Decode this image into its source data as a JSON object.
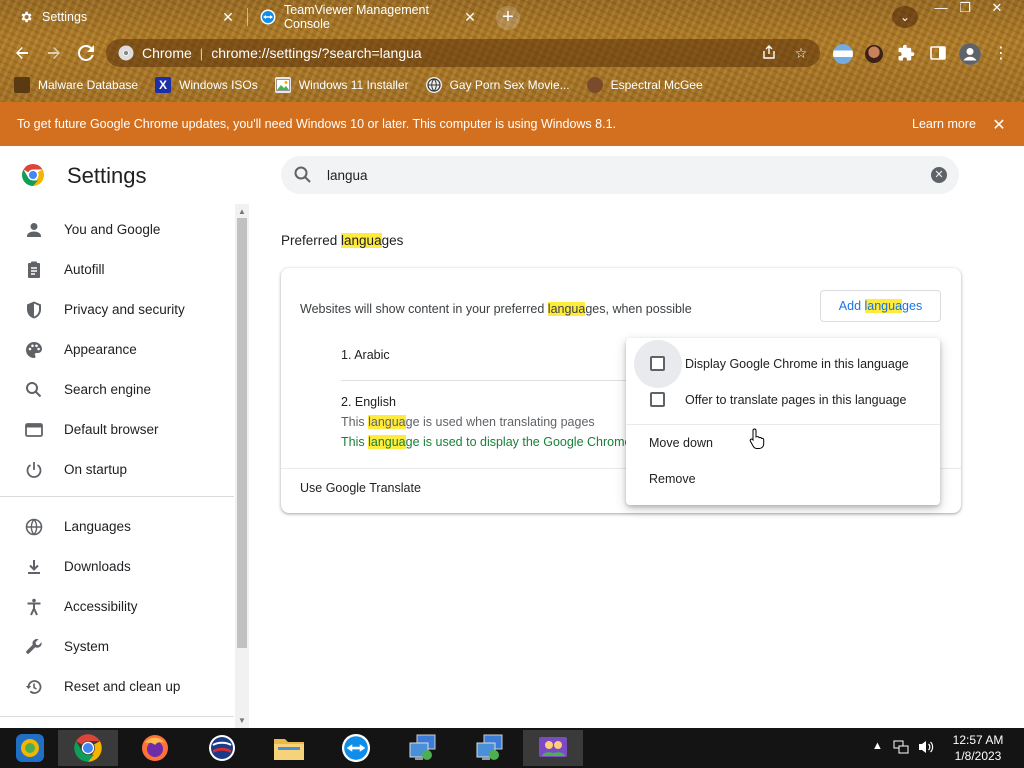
{
  "tabs": [
    {
      "title": "Settings",
      "icon": "gear-icon",
      "active": true
    },
    {
      "title": "TeamViewer Management Console",
      "icon": "teamviewer-icon",
      "active": false
    }
  ],
  "window_controls": {
    "minimize": "—",
    "restore": "❐",
    "close": "✕"
  },
  "toolbar": {
    "site_name": "Chrome",
    "url": "chrome://settings/?search=langua"
  },
  "bookmarks": [
    {
      "label": "Malware Database",
      "icon": "malware-database-icon"
    },
    {
      "label": "Windows ISOs",
      "icon": "windows-isos-icon"
    },
    {
      "label": "Windows 11 Installer",
      "icon": "image-icon"
    },
    {
      "label": "Gay Porn Sex Movie...",
      "icon": "globe-favicon-icon"
    },
    {
      "label": "Espectral McGee",
      "icon": "person-favicon-icon"
    }
  ],
  "infobar": {
    "message": "To get future Google Chrome updates, you'll need Windows 10 or later. This computer is using Windows 8.1.",
    "link": "Learn more"
  },
  "settings": {
    "title": "Settings",
    "search_value": "langua"
  },
  "sidenav": {
    "items": [
      {
        "label": "You and Google",
        "icon": "person-icon"
      },
      {
        "label": "Autofill",
        "icon": "clipboard-icon"
      },
      {
        "label": "Privacy and security",
        "icon": "shield-icon"
      },
      {
        "label": "Appearance",
        "icon": "palette-icon"
      },
      {
        "label": "Search engine",
        "icon": "search-icon"
      },
      {
        "label": "Default browser",
        "icon": "browser-window-icon"
      },
      {
        "label": "On startup",
        "icon": "power-icon"
      },
      {
        "label": "Languages",
        "icon": "globe-icon"
      },
      {
        "label": "Downloads",
        "icon": "download-icon"
      },
      {
        "label": "Accessibility",
        "icon": "accessibility-icon"
      },
      {
        "label": "System",
        "icon": "wrench-icon"
      },
      {
        "label": "Reset and clean up",
        "icon": "restore-icon"
      }
    ]
  },
  "languages_section": {
    "title_pre": "Preferred ",
    "title_hl": "langua",
    "title_post": "ges",
    "desc_pre": "Websites will show content in your preferred ",
    "desc_hl": "langua",
    "desc_post": "ges, when possible",
    "add_pre": "Add ",
    "add_hl": "langua",
    "add_post": "ges",
    "lang1": "1. Arabic",
    "lang2": "2. English",
    "note1_pre": "This ",
    "note1_hl": "langua",
    "note1_post": "ge is used when translating pages",
    "note2_pre": "This ",
    "note2_hl": "langua",
    "note2_post": "ge is used to display the Google Chrome UI",
    "translate_label": "Use Google Translate"
  },
  "context_menu": {
    "display_chrome": "Display Google Chrome in this language",
    "offer_translate": "Offer to translate pages in this language",
    "move_down": "Move down",
    "remove": "Remove",
    "display_checked": false,
    "offer_checked": false
  },
  "taskbar": {
    "apps": [
      {
        "name": "app-launcher",
        "icon": "start-app-icon"
      },
      {
        "name": "chrome",
        "icon": "chrome-icon",
        "active": true
      },
      {
        "name": "firefox",
        "icon": "firefox-icon"
      },
      {
        "name": "app-circle",
        "icon": "circle-logo-icon"
      },
      {
        "name": "file-explorer",
        "icon": "folder-icon"
      },
      {
        "name": "teamviewer",
        "icon": "teamviewer-icon"
      },
      {
        "name": "remote-desktop-1",
        "icon": "remote-desktop-icon"
      },
      {
        "name": "remote-desktop-2",
        "icon": "remote-desktop-icon"
      },
      {
        "name": "users-app",
        "icon": "users-icon"
      }
    ],
    "time": "12:57 AM",
    "date": "1/8/2023"
  },
  "colors": {
    "accent": "#1a73e8",
    "infobar": "#d37020",
    "highlight": "#ffeb3b",
    "green_note": "#188038"
  }
}
